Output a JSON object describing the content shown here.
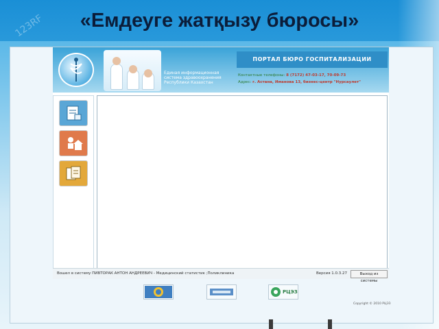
{
  "slide": {
    "title": "«Емдеуге жатқызу бюросы»",
    "watermark": "123RF"
  },
  "app": {
    "header": {
      "description": "Единая информационная система здравоохранения Республики Казахстан",
      "portal_title": "ПОРТАЛ БЮРО ГОСПИТАЛИЗАЦИИ",
      "phone_label": "Контактные телефоны:",
      "phone_value": "8 (7172) 47-03-17, 70-09-73",
      "address_label": "Адрес:",
      "address_value": "г. Астана, Иманова 13, бизнес-центр \"Нурсаулет\""
    },
    "sidebar": {
      "items": [
        {
          "icon": "patient-card-icon",
          "color": "#5aa6d6"
        },
        {
          "icon": "hospital-referral-icon",
          "color": "#e07a4b"
        },
        {
          "icon": "documents-icon",
          "color": "#e3a83a"
        }
      ]
    },
    "status": {
      "user_text": "Вошел в систему ПИВТОРАК АНТОН АНДРЕЕВИЧ - Медицинский статистик ;Поликлиника",
      "version_text": "Версия 1.0.3.27",
      "logout_label": "Выход из системы"
    },
    "partners": [
      {
        "icon": "ministry-logo-icon"
      },
      {
        "icon": "egov-logo-icon"
      },
      {
        "icon": "rcez-logo-icon",
        "label": "РЦЭЗ"
      }
    ],
    "copyright": "Copyright © 2010 РЦЭЗ"
  },
  "colors": {
    "accent": "#2f8ec7",
    "slide_bg": "#1a8fd6",
    "title_text": "#0b1d3a"
  }
}
